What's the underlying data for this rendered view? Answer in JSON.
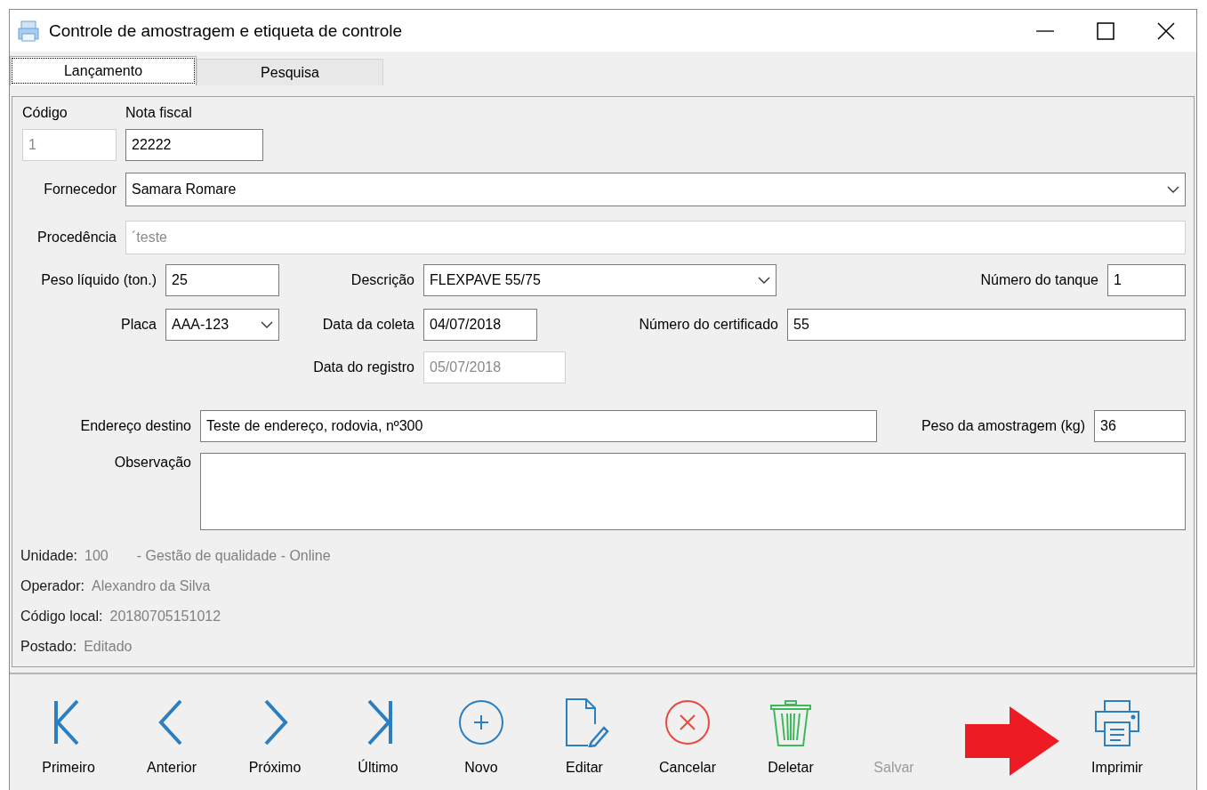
{
  "window": {
    "title": "Controle de amostragem e etiqueta de controle"
  },
  "tabs": [
    {
      "label": "Lançamento",
      "selected": true
    },
    {
      "label": "Pesquisa",
      "selected": false
    }
  ],
  "fields": [
    {
      "label": "Código",
      "value": "1",
      "kind": "text",
      "disabled": true
    },
    {
      "label": "Nota fiscal",
      "value": "22222",
      "kind": "text",
      "disabled": false
    },
    {
      "label": "Fornecedor",
      "value": "Samara Romare",
      "kind": "combo",
      "disabled": false
    },
    {
      "label": "Procedência",
      "value": "´teste",
      "kind": "text",
      "disabled": true
    },
    {
      "label": "Peso líquido (ton.)",
      "value": "25",
      "kind": "text",
      "disabled": false
    },
    {
      "label": "Descrição",
      "value": "FLEXPAVE 55/75",
      "kind": "combo",
      "disabled": false
    },
    {
      "label": "Número do tanque",
      "value": "1",
      "kind": "text",
      "disabled": false
    },
    {
      "label": "Placa",
      "value": "AAA-123",
      "kind": "combo",
      "disabled": false
    },
    {
      "label": "Data da coleta",
      "value": "04/07/2018",
      "kind": "text",
      "disabled": false
    },
    {
      "label": "Número do certificado",
      "value": "55",
      "kind": "text",
      "disabled": false
    },
    {
      "label": "Data do registro",
      "value": "05/07/2018",
      "kind": "text",
      "disabled": true
    },
    {
      "label": "Endereço destino",
      "value": "Teste de endereço, rodovia, nº300",
      "kind": "text",
      "disabled": false
    },
    {
      "label": "Peso da amostragem (kg)",
      "value": "36",
      "kind": "text",
      "disabled": false
    },
    {
      "label": "Observação",
      "kind": "memo",
      "disabled": false
    }
  ],
  "info": [
    {
      "label": "Unidade:",
      "value": "100",
      "detail": "- Gestão de qualidade - Online"
    },
    {
      "label": "Operador:",
      "value": "Alexandro da Silva"
    },
    {
      "label": "Código local:",
      "value": "20180705151012"
    },
    {
      "label": "Postado:",
      "value": "Editado"
    }
  ],
  "toolbar": [
    {
      "label": "Primeiro",
      "kind": "first",
      "disabled": false
    },
    {
      "label": "Anterior",
      "kind": "previous",
      "disabled": false
    },
    {
      "label": "Próximo",
      "kind": "next",
      "disabled": false
    },
    {
      "label": "Último",
      "kind": "last",
      "disabled": false
    },
    {
      "label": "Novo",
      "kind": "new",
      "disabled": false
    },
    {
      "label": "Editar",
      "kind": "edit",
      "disabled": false
    },
    {
      "label": "Cancelar",
      "kind": "cancel",
      "disabled": false
    },
    {
      "label": "Deletar",
      "kind": "delete",
      "disabled": false
    },
    {
      "label": "Salvar",
      "kind": "save",
      "disabled": true
    },
    {
      "label": "Imprimir",
      "kind": "print",
      "disabled": false
    }
  ]
}
